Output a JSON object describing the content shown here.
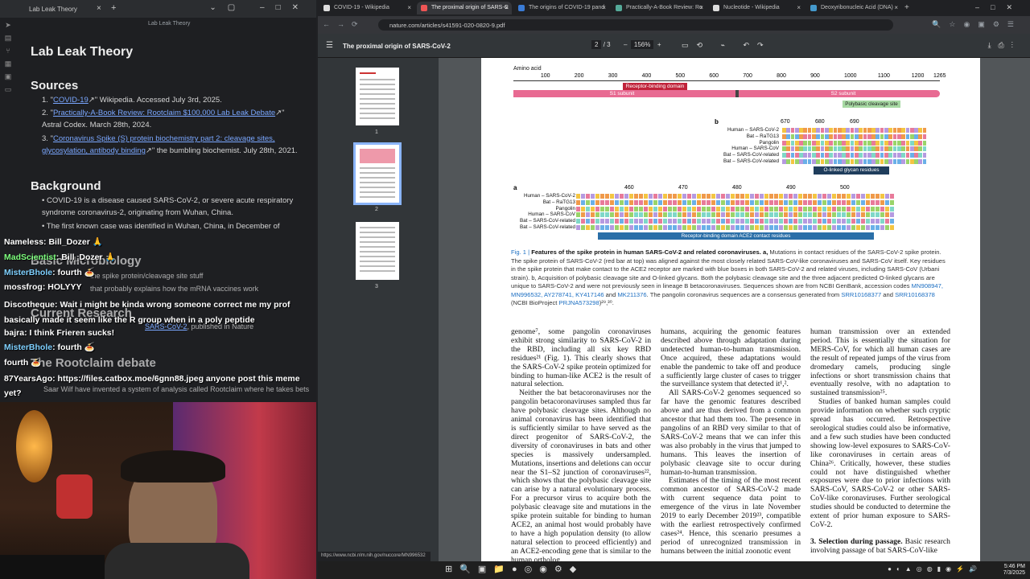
{
  "left_window": {
    "title": "Lab Leak Theory",
    "toolbar_title": "Lab Leak Theory",
    "note": {
      "heading": "Lab Leak Theory",
      "sources_heading": "Sources",
      "sources": [
        {
          "n": "1.",
          "link": "COVID-19",
          "rest": "\" Wikipedia. Accessed July 3rd, 2025."
        },
        {
          "n": "2.",
          "link": "Practically-A-Book Review: Rootclaim $100,000 Lab Leak Debate",
          "rest": "\"",
          "rest2": "Astral Codex. March 28th, 2024."
        },
        {
          "n": "3.",
          "link": "Coronavirus Spike (S) protein biochemistry part 2: cleavage sites, glycosylation, antibody binding",
          "rest": "\" the bumbling biochemist. July 28th, 2021."
        }
      ],
      "background_heading": "Background",
      "background": [
        "COVID-19 is a disease caused SARS-CoV-2, or severe acute respiratory syndrome coronavirus-2, originating from Wuhan, China.",
        "The first known case was identified in Wuhan, China, in December of"
      ],
      "micro_heading": "Basic Microbiology",
      "micro_item": "the spike protein/cleavage site stuff",
      "micro_item2": "that probably explains how the mRNA vaccines work",
      "research_heading": "Current Research",
      "research_item": "SARS-CoV-2",
      "research_item_rest": ", published in Nature",
      "debate_heading": "The Rootclaim debate",
      "debate_item": "Saar Wilf have invented a system of analysis called Rootclaim where he takes bets"
    }
  },
  "chat": [
    {
      "user": "Nameless",
      "color": "#ffffff",
      "msg": "Bill_Dozer 🙏"
    },
    {
      "user": "MadScientist",
      "color": "#7dff7d",
      "msg": "Bill_Dozer 🙏"
    },
    {
      "user": "MisterBhole",
      "color": "#7fd0ff",
      "msg": "fourth 🍝"
    },
    {
      "user": "mossfrog",
      "color": "#ffffff",
      "msg": "HOLYYY"
    },
    {
      "user": "Discotheque",
      "color": "#ffffff",
      "msg": "Wait i might be kinda wrong someone correct me my prof basically made it seem like the R group when in a poly peptide"
    },
    {
      "user": "bajra",
      "color": "#ffffff",
      "msg": "I think Frieren sucks!"
    },
    {
      "user": "MisterBhole",
      "color": "#7fd0ff",
      "msg": "fourth 🍝"
    },
    {
      "user": "",
      "color": "#ffffff",
      "msg": "fourth 🍝"
    },
    {
      "user": "87YearsAgo",
      "color": "#ffffff",
      "msg": "https://files.catbox.moe/6gnn88.jpeg anyone post this meme yet?"
    }
  ],
  "browser": {
    "tabs": [
      {
        "label": "COVID-19 - Wikipedia",
        "active": false
      },
      {
        "label": "The proximal origin of SARS-C",
        "active": true
      },
      {
        "label": "The origins of COVID-19 pand",
        "active": false
      },
      {
        "label": "Practically-A-Book Review: Ro",
        "active": false
      },
      {
        "label": "Nucleotide - Wikipedia",
        "active": false
      },
      {
        "label": "Deoxyribonucleic Acid (DNA)",
        "active": false
      }
    ],
    "url": "nature.com/articles/s41591-020-0820-9.pdf",
    "pdf_title": "The proximal origin of SARS-CoV-2",
    "page_current": "2",
    "page_total": "/ 3",
    "zoom": "156%",
    "thumb_labels": [
      "1",
      "2",
      "3"
    ],
    "status_url": "https://www.ncbi.nlm.nih.gov/nuccore/MN996532",
    "clock_time": "5:46 PM",
    "clock_date": "7/3/2025"
  },
  "figure": {
    "amino_acid_label": "Amino acid",
    "ticks": [
      "100",
      "200",
      "300",
      "400",
      "500",
      "600",
      "700",
      "800",
      "900",
      "1000",
      "1100",
      "1200",
      "1265"
    ],
    "rbd_label": "Receptor-binding domain",
    "s1_label": "S1 subunit",
    "s2_label": "S2 subunit",
    "cleavage_label": "Polybasic cleavage site",
    "olinked_label": "O-linked glycan residues",
    "ace2_label": "Receptor-binding domain ACE2 contact residues",
    "panel_a": "a",
    "panel_b": "b",
    "b_ticks": [
      "670",
      "680",
      "690"
    ],
    "a_ticks": [
      "460",
      "470",
      "480",
      "490",
      "500"
    ],
    "b_species": [
      "Human – SARS-CoV-2",
      "Bat – RaTG13",
      "Pangolin",
      "Human – SARS-CoV",
      "Bat – SARS-CoV-related",
      "Bat – SARS-CoV-related"
    ],
    "a_species": [
      "Human – SARS-CoV-2",
      "Bat – RaTG13",
      "Pangolin",
      "Human – SARS-CoV",
      "Bat – SARS-CoV-related",
      "Bat – SARS-CoV-related"
    ],
    "caption_fig": "Fig. 1 |",
    "caption_bold": " Features of the spike protein in human SARS-CoV-2 and related coronaviruses. a,",
    "caption_text": " Mutations in contact residues of the SARS-CoV-2 spike protein. The spike protein of SARS-CoV-2 (red bar at top) was aligned against the most closely related SARS-CoV-like coronaviruses and SARS-CoV itself. Key residues in the spike protein that make contact to the ACE2 receptor are marked with blue boxes in both SARS-CoV-2 and related viruses, including SARS-CoV (Urbani strain). b, Acquisition of polybasic cleavage site and O-linked glycans. Both the polybasic cleavage site and the three adjacent predicted O-linked glycans are unique to SARS-CoV-2 and were not previously seen in lineage B betacoronaviruses. Sequences shown are from NCBI GenBank, accession codes ",
    "caption_links1": "MN908947, MN996532, AY278741, KY417146",
    "caption_and": " and ",
    "caption_links2": "MK211376",
    "caption_text2": ". The pangolin coronavirus sequences are a consensus generated from ",
    "caption_links3": "SRR10168377",
    "caption_and2": " and ",
    "caption_links4": "SRR10168378",
    "caption_text3": " (NCBI BioProject ",
    "caption_links5": "PRJNA573298",
    "caption_end": ")²⁹,³⁰."
  },
  "columns": {
    "col1": [
      "genome⁷, some pangolin coronaviruses exhibit strong similarity to SARS-CoV-2 in the RBD, including all six key RBD residues²¹ (Fig. 1). This clearly shows that the SARS-CoV-2 spike protein optimized for binding to human-like ACE2 is the result of natural selection.",
      "Neither the bat betacoronaviruses nor the pangolin betacoronaviruses sampled thus far have polybasic cleavage sites. Although no animal coronavirus has been identified that is sufficiently similar to have served as the direct progenitor of SARS-CoV-2, the diversity of coronaviruses in bats and other species is massively undersampled. Mutations, insertions and deletions can occur near the S1–S2 junction of coronaviruses²², which shows that the polybasic cleavage site can arise by a natural evolutionary process. For a precursor virus to acquire both the polybasic cleavage site and mutations in the spike protein suitable for binding to human ACE2, an animal host would probably have to have a high population density (to allow natural selection to proceed efficiently) and an ACE2-encoding gene that is similar to the human ortholog."
    ],
    "col2": [
      "humans, acquiring the genomic features described above through adaptation during undetected human-to-human transmission. Once acquired, these adaptations would enable the pandemic to take off and produce a sufficiently large cluster of cases to trigger the surveillance system that detected it¹,².",
      "All SARS-CoV-2 genomes sequenced so far have the genomic features described above and are thus derived from a common ancestor that had them too. The presence in pangolins of an RBD very similar to that of SARS-CoV-2 means that we can infer this was also probably in the virus that jumped to humans. This leaves the insertion of polybasic cleavage site to occur during human-to-human transmission.",
      "Estimates of the timing of the most recent common ancestor of SARS-CoV-2 made with current sequence data point to emergence of the virus in late November 2019 to early December 2019²³, compatible with the earliest retrospectively confirmed cases²⁴. Hence, this scenario presumes a period of unrecognized transmission in humans between the initial zoonotic event"
    ],
    "col3": [
      "human transmission over an extended period. This is essentially the situation for MERS-CoV, for which all human cases are the result of repeated jumps of the virus from dromedary camels, producing single infections or short transmission chains that eventually resolve, with no adaptation to sustained transmission²⁵.",
      "Studies of banked human samples could provide information on whether such cryptic spread has occurred. Retrospective serological studies could also be informative, and a few such studies have been conducted showing low-level exposures to SARS-CoV-like coronaviruses in certain areas of China²⁶. Critically, however, these studies could not have distinguished whether exposures were due to prior infections with SARS-CoV, SARS-CoV-2 or other SARS-CoV-like coronaviruses. Further serological studies should be conducted to determine the extent of prior human exposure to SARS-CoV-2."
    ],
    "col3_heading": "3. Selection during passage.",
    "col3_heading_rest": " Basic research involving passage of bat SARS-CoV-like"
  }
}
